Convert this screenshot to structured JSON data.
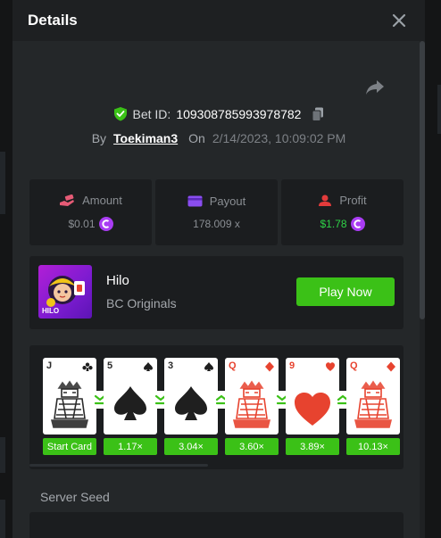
{
  "dialog": {
    "title": "Details"
  },
  "bet": {
    "id_label": "Bet ID:",
    "id": "109308785993978782",
    "by_label": "By",
    "user": "Toekiman3",
    "on_label": "On",
    "date": "2/14/2023, 10:09:02 PM"
  },
  "stats": [
    {
      "label": "Amount",
      "value": "$0.01",
      "icon": "money-hand-icon",
      "coin": true,
      "win": false
    },
    {
      "label": "Payout",
      "value": "178.009 x",
      "icon": "card-payout-icon",
      "coin": false,
      "win": false
    },
    {
      "label": "Profit",
      "value": "$1.78",
      "icon": "user-profit-icon",
      "coin": true,
      "win": true
    }
  ],
  "game": {
    "name": "Hilo",
    "provider": "BC Originals",
    "play_label": "Play Now",
    "thumb_label": "HILO"
  },
  "cards": [
    {
      "rank": "J",
      "suit": "clubs",
      "color": "black",
      "multiplier": "Start Card",
      "arrow": "down"
    },
    {
      "rank": "5",
      "suit": "spades",
      "color": "black",
      "multiplier": "1.17×",
      "arrow": "down"
    },
    {
      "rank": "3",
      "suit": "spades",
      "color": "black",
      "multiplier": "3.04×",
      "arrow": "up"
    },
    {
      "rank": "Q",
      "suit": "diamonds",
      "color": "red",
      "multiplier": "3.60×",
      "arrow": "down"
    },
    {
      "rank": "9",
      "suit": "hearts",
      "color": "red",
      "multiplier": "3.89×",
      "arrow": "up"
    },
    {
      "rank": "Q",
      "suit": "diamonds",
      "color": "red",
      "multiplier": "10.13×",
      "arrow": null
    }
  ],
  "seed": {
    "label": "Server Seed"
  },
  "colors": {
    "accent_green": "#3bc117",
    "win_green": "#2fd347",
    "coin_purple": "#a93cf3",
    "card_red": "#e7432f",
    "icon_pink": "#e65b76",
    "icon_purple": "#8a4df0",
    "icon_red": "#e23b3b"
  }
}
